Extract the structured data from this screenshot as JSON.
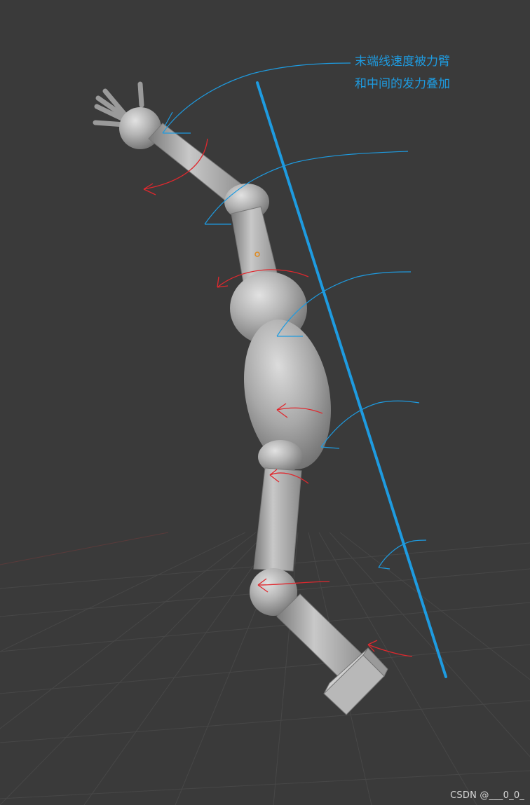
{
  "annotation": {
    "line1": "末端线速度被力臂",
    "line2": "和中间的发力叠加"
  },
  "watermark": "CSDN @___0_0_",
  "colors": {
    "background": "#3a3a3a",
    "grid": "#454545",
    "model": "#a9a9a9",
    "annotation_blue": "#1e9be0",
    "arrow_red": "#e0282e"
  },
  "scene": {
    "model": "segmented-arm-3d-viewport",
    "tool": "freehand-annotation"
  }
}
